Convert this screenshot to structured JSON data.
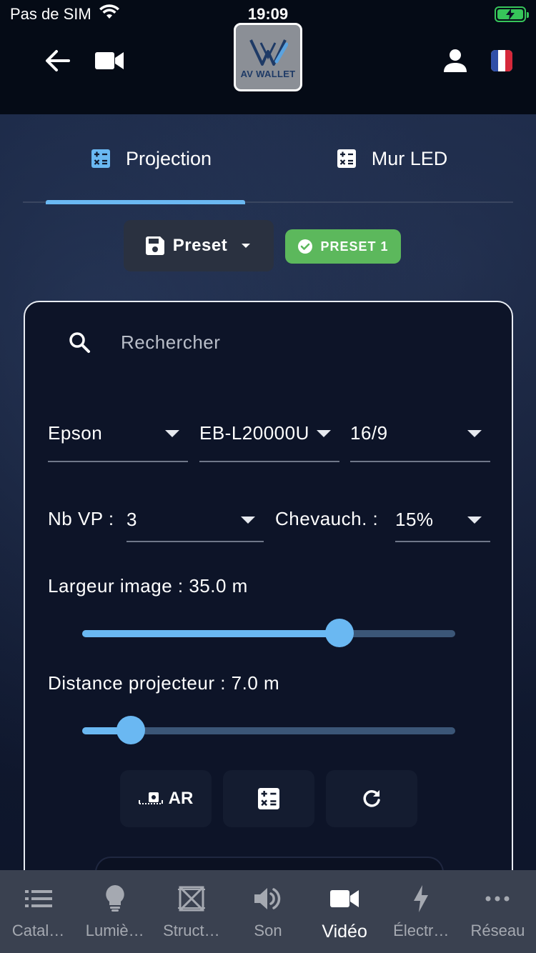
{
  "status_bar": {
    "carrier": "Pas de SIM",
    "time": "19:09"
  },
  "header": {
    "logo_text": "AV WALLET"
  },
  "tabs": [
    {
      "label": "Projection",
      "active": true
    },
    {
      "label": "Mur LED",
      "active": false
    }
  ],
  "preset": {
    "button_label": "Preset",
    "badge_label": "PRESET 1"
  },
  "search": {
    "placeholder": "Rechercher"
  },
  "selectors": {
    "brand": "Epson",
    "model": "EB-L20000U",
    "ratio": "16/9",
    "nb_vp_label": "Nb VP : ",
    "nb_vp_value": "3",
    "overlap_label": "Chevauch. : ",
    "overlap_value": "15%"
  },
  "sliders": {
    "width_label": "Largeur image : 35.0 m",
    "width_fraction": 0.69,
    "distance_label": "Distance projecteur : 7.0 m",
    "distance_fraction": 0.13
  },
  "actions": {
    "ar_label": "AR"
  },
  "bottom_nav": [
    {
      "label": "Catal…",
      "icon": "list-icon"
    },
    {
      "label": "Lumiè…",
      "icon": "lightbulb-icon"
    },
    {
      "label": "Struct…",
      "icon": "truss-icon"
    },
    {
      "label": "Son",
      "icon": "speaker-icon"
    },
    {
      "label": "Vidéo",
      "icon": "video-camera-icon",
      "active": true
    },
    {
      "label": "Électr…",
      "icon": "lightning-icon"
    },
    {
      "label": "Réseau",
      "icon": "more-icon"
    }
  ],
  "colors": {
    "accent": "#6ab8f2",
    "badge_green": "#5cb85c",
    "battery_green": "#37c55a",
    "header_bg": "#050b16",
    "nav_bg": "#3a4150"
  }
}
